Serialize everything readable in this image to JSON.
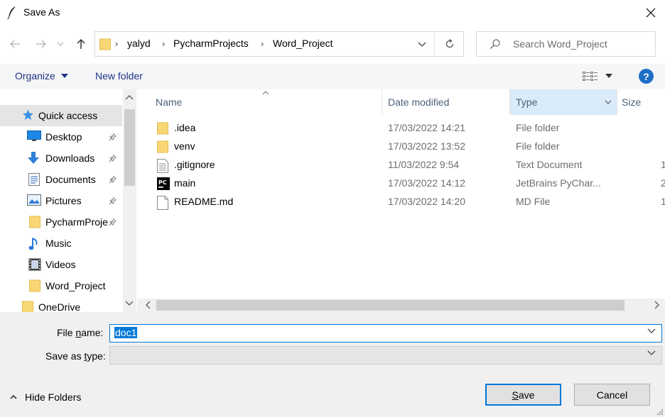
{
  "window": {
    "title": "Save As"
  },
  "address": {
    "crumbs": [
      "yalyd",
      "PycharmProjects",
      "Word_Project"
    ]
  },
  "search": {
    "placeholder": "Search Word_Project"
  },
  "commands": {
    "organize": "Organize",
    "new_folder": "New folder"
  },
  "nav": {
    "items": [
      {
        "label": "Quick access",
        "icon": "star-icon"
      },
      {
        "label": "Desktop",
        "icon": "desktop-icon",
        "pinned": true
      },
      {
        "label": "Downloads",
        "icon": "download-arrow-icon",
        "pinned": true
      },
      {
        "label": "Documents",
        "icon": "documents-icon",
        "pinned": true
      },
      {
        "label": "Pictures",
        "icon": "pictures-icon",
        "pinned": true
      },
      {
        "label": "PycharmProjects",
        "icon": "folder-icon",
        "pinned": true
      },
      {
        "label": "Music",
        "icon": "music-note-icon"
      },
      {
        "label": "Videos",
        "icon": "videos-icon"
      },
      {
        "label": "Word_Project",
        "icon": "folder-icon"
      },
      {
        "label": "OneDrive",
        "icon": "folder-icon"
      }
    ]
  },
  "columns": {
    "name": "Name",
    "date": "Date modified",
    "type": "Type",
    "size": "Size"
  },
  "files": [
    {
      "name": ".idea",
      "date": "17/03/2022 14:21",
      "type": "File folder",
      "size": "",
      "icon": "folder-icon"
    },
    {
      "name": "venv",
      "date": "17/03/2022 13:52",
      "type": "File folder",
      "size": "",
      "icon": "folder-icon"
    },
    {
      "name": ".gitignore",
      "date": "11/03/2022 9:54",
      "type": "Text Document",
      "size": "1",
      "icon": "text-file-icon"
    },
    {
      "name": "main",
      "date": "17/03/2022 14:12",
      "type": "JetBrains PyChar...",
      "size": "2",
      "icon": "pycharm-icon"
    },
    {
      "name": "README.md",
      "date": "17/03/2022 14:20",
      "type": "MD File",
      "size": "1",
      "icon": "blank-file-icon"
    }
  ],
  "form": {
    "file_name_label_pre": "File ",
    "file_name_label_key": "n",
    "file_name_label_post": "ame:",
    "file_name_value": "doc1",
    "save_type_label_pre": "Save as ",
    "save_type_label_key": "t",
    "save_type_label_post": "ype:",
    "save_type_value": ""
  },
  "footer": {
    "hide_folders": "Hide Folders",
    "save_key": "S",
    "save_rest": "ave",
    "cancel": "Cancel"
  },
  "colors": {
    "accent": "#0078d7",
    "link": "#1e3287",
    "selected_col": "#d9ebf9"
  }
}
